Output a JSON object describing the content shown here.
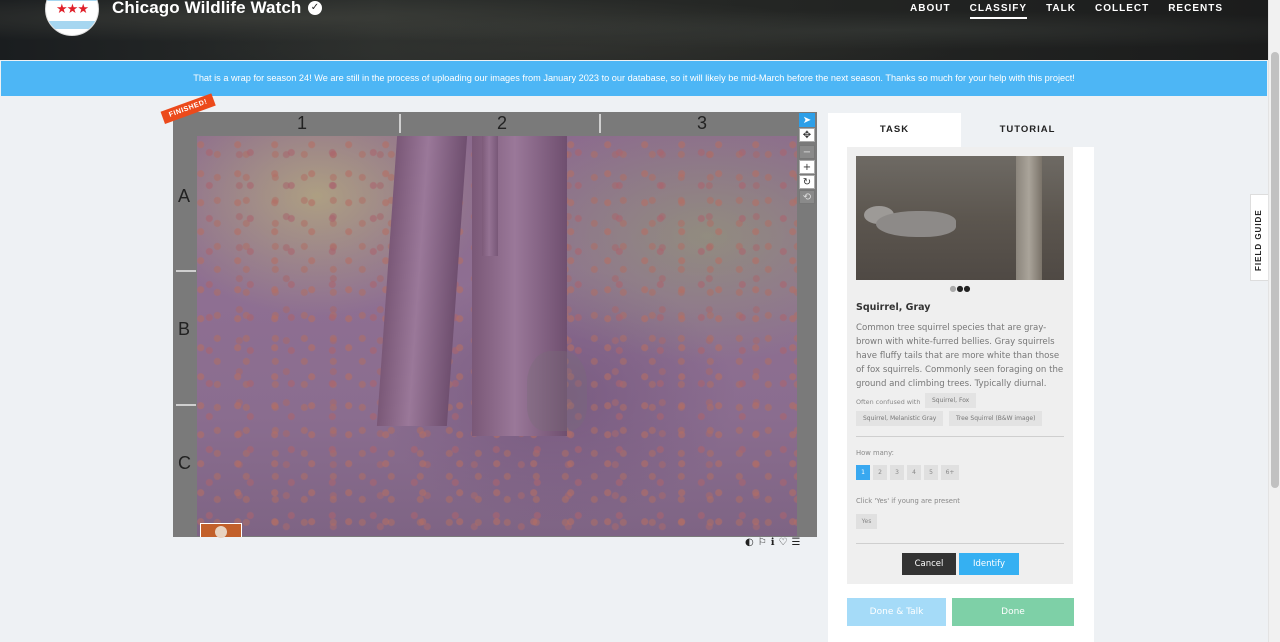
{
  "header": {
    "site_title": "Chicago Wildlife Watch",
    "logo_stars": "★★★",
    "nav": [
      "ABOUT",
      "CLASSIFY",
      "TALK",
      "COLLECT",
      "RECENTS"
    ],
    "active_nav": "CLASSIFY"
  },
  "banner": {
    "text": "That is a wrap for season 24! We are still in the process of uploading our images from January 2023 to our database, so it will likely be mid-March before the next season. Thanks so much for your help with this project!"
  },
  "viewer": {
    "finished_badge": "FINISHED!",
    "columns": [
      "1",
      "2",
      "3"
    ],
    "rows": [
      "A",
      "B",
      "C"
    ],
    "tools": [
      "pointer-icon",
      "move-icon",
      "zoom-out-icon",
      "zoom-in-icon",
      "rotate-icon",
      "reset-icon"
    ],
    "meta_icons": [
      "invert-icon",
      "flag-icon",
      "info-icon",
      "favorite-icon",
      "collections-icon"
    ]
  },
  "task_panel": {
    "tabs": [
      "TASK",
      "TUTORIAL"
    ],
    "active_tab": "TASK",
    "species_name": "Squirrel, Gray",
    "description": "Common tree squirrel species that are gray-brown with white-furred bellies. Gray squirrels have fluffy tails that are more white than those of fox squirrels. Commonly seen foraging on the ground and climbing trees. Typically diurnal.",
    "confused_label": "Often confused with",
    "confused_with": [
      "Squirrel, Fox",
      "Squirrel, Melanistic Gray",
      "Tree Squirrel (B&W image)"
    ],
    "how_many_label": "How many:",
    "how_many_options": [
      "1",
      "2",
      "3",
      "4",
      "5",
      "6+"
    ],
    "how_many_selected": "1",
    "young_label": "Click 'Yes' if young are present",
    "young_option": "Yes",
    "cancel": "Cancel",
    "identify": "Identify",
    "done_talk": "Done & Talk",
    "done": "Done"
  },
  "field_guide": "FIELD GUIDE"
}
